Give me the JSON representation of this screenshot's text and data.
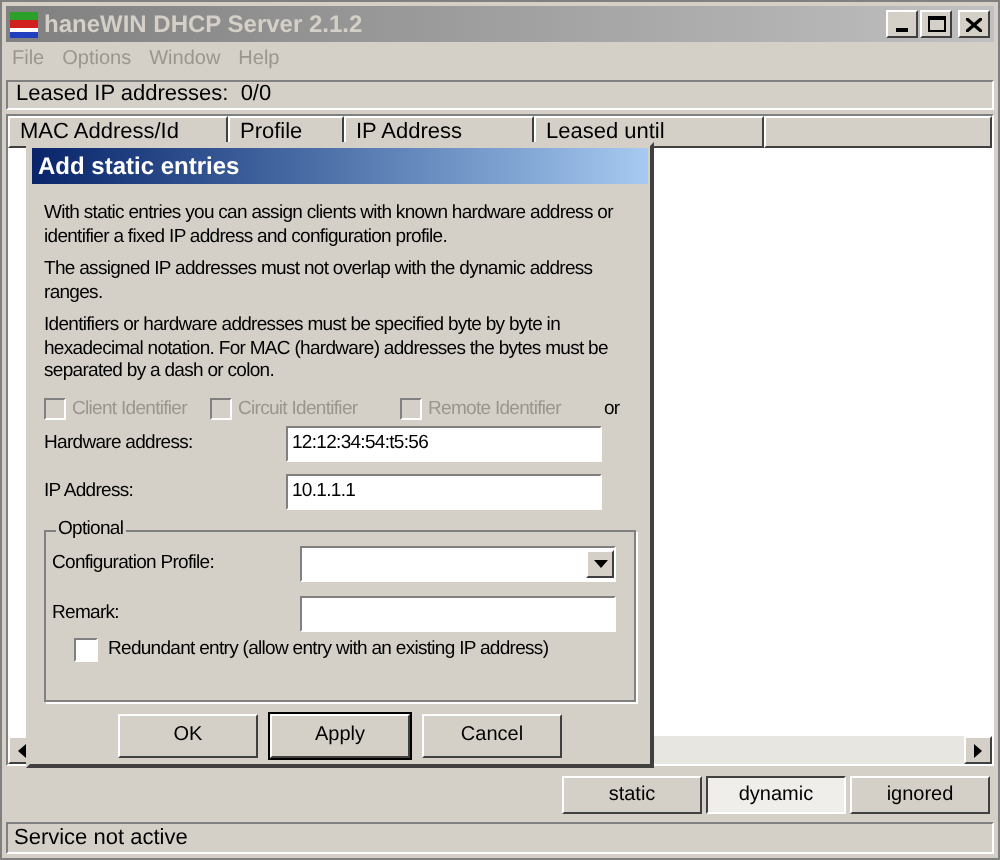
{
  "window": {
    "title": "haneWIN DHCP Server 2.1.2"
  },
  "menu": [
    {
      "label": "File",
      "disabled": true
    },
    {
      "label": "Options",
      "disabled": true
    },
    {
      "label": "Window",
      "disabled": true
    },
    {
      "label": "Help",
      "disabled": true
    }
  ],
  "leased_summary": "Leased IP addresses:  0/0",
  "table": {
    "columns": [
      "MAC Address/Id",
      "Profile",
      "IP Address",
      "Leased until"
    ]
  },
  "dialog": {
    "title": "Add static entries",
    "paragraphs": [
      "With static entries you can assign clients with known hardware address or identifier a fixed IP address and configuration profile.",
      "The assigned IP addresses must not overlap with the dynamic address ranges.",
      "Identifiers or hardware addresses must be specified byte by byte in hexadecimal notation. For MAC (hardware) addresses the bytes must be separated by a dash or colon."
    ],
    "identifier_options": [
      {
        "label": "Client Identifier",
        "checked": false,
        "disabled": true
      },
      {
        "label": "Circuit Identifier",
        "checked": false,
        "disabled": true
      },
      {
        "label": "Remote Identifier",
        "checked": false,
        "disabled": true
      }
    ],
    "or_label": "or",
    "fields": [
      {
        "label": "Hardware address:",
        "value": "12:12:34:54:t5:56"
      },
      {
        "label": "IP Address:",
        "value": "10.1.1.1"
      }
    ],
    "optional_group": {
      "title": "Optional",
      "profile_label": "Configuration Profile:",
      "remark_label": "Remark:",
      "redundant": {
        "label": "Redundant entry (allow entry with an existing IP address)",
        "checked": false
      }
    },
    "buttons": [
      {
        "label": "OK",
        "default": false
      },
      {
        "label": "Apply",
        "default": true
      },
      {
        "label": "Cancel",
        "default": false
      }
    ]
  },
  "view_tabs": [
    {
      "label": "static",
      "selected": false
    },
    {
      "label": "dynamic",
      "selected": true
    },
    {
      "label": "ignored",
      "selected": false
    }
  ],
  "status_bar": "Service not active"
}
